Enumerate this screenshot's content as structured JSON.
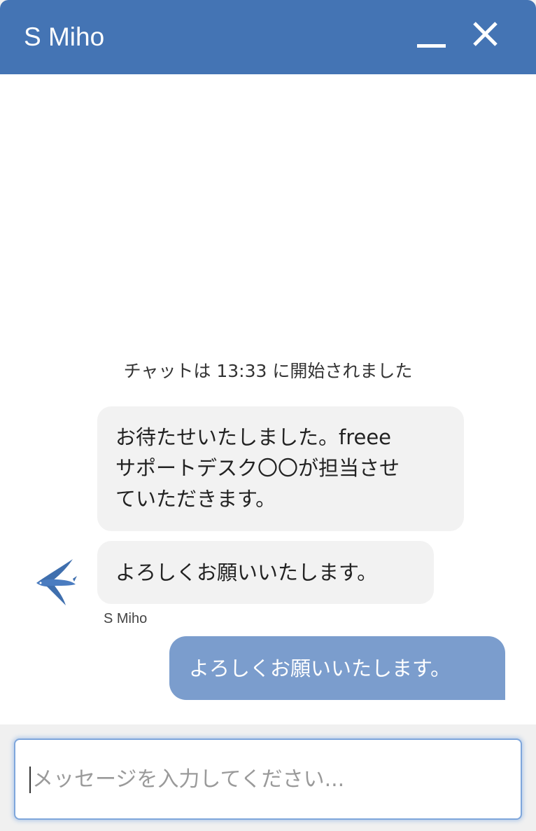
{
  "window": {
    "title": "S Miho",
    "accent_color": "#4474b4"
  },
  "controls": {
    "minimize_icon": "minimize-icon",
    "close_icon": "close-icon"
  },
  "chat": {
    "start_note": "チャットは 13:33 に開始されました",
    "messages": [
      {
        "from": "agent",
        "lines": [
          "お待たせいたしました。freee",
          "サポートデスク〇〇が担当させ",
          "ていただきます。"
        ]
      },
      {
        "from": "agent",
        "text": "よろしくお願いいたします。",
        "sender_name": "S Miho",
        "avatar_icon": "swallow-bird-icon"
      },
      {
        "from": "user",
        "text": "よろしくお願いいたします。",
        "bubble_color": "#7b9dcd"
      }
    ]
  },
  "composer": {
    "placeholder": "メッセージを入力してください..."
  }
}
